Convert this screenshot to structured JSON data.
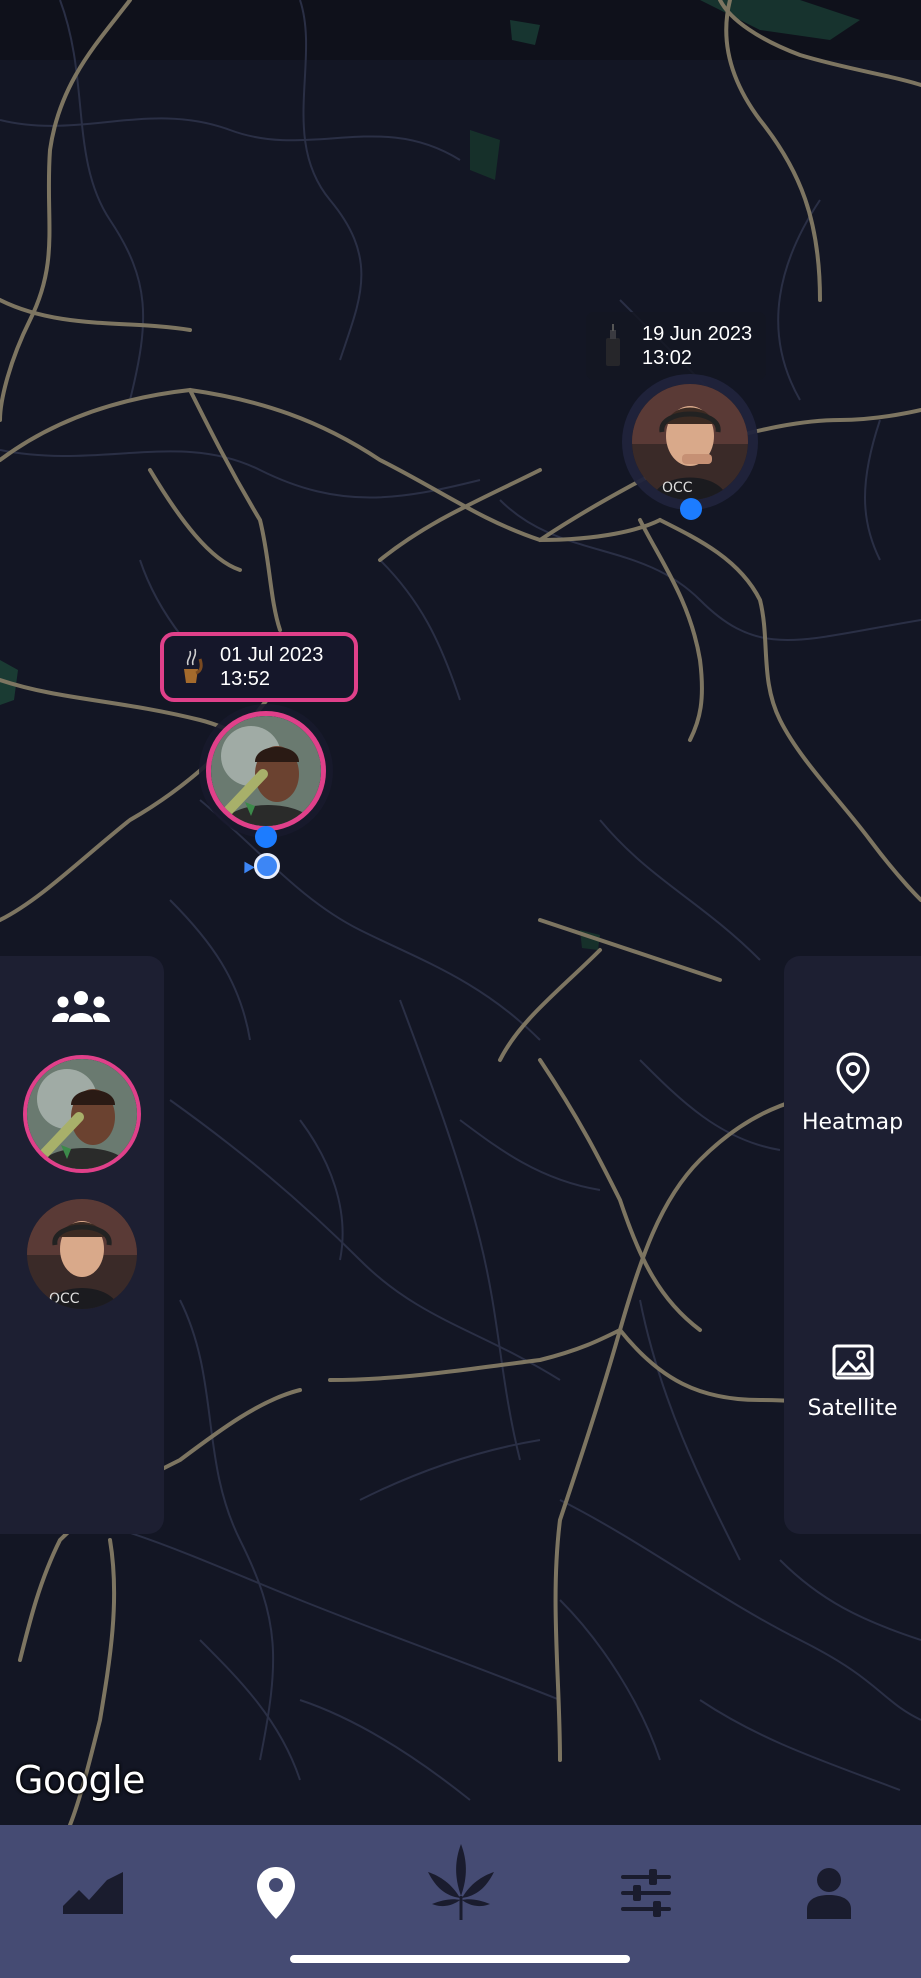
{
  "map": {
    "attribution": "Google",
    "colors": {
      "background": "#131624",
      "major_road": "#8a8068",
      "minor_road": "#2c3146",
      "park": "#1b3a34"
    }
  },
  "markers": [
    {
      "date": "01 Jul 2023",
      "time": "13:52",
      "icon": "pipe-icon",
      "selected": true,
      "ring_color": "#e0408a"
    },
    {
      "date": "19 Jun 2023",
      "time": "13:02",
      "icon": "vape-icon",
      "selected": false
    }
  ],
  "left_panel": {
    "group_icon": "group-icon",
    "friends": [
      {
        "name": "friend-1",
        "active": true
      },
      {
        "name": "friend-2",
        "active": false
      }
    ]
  },
  "right_panel": {
    "heatmap_label": "Heatmap",
    "heatmap_icon": "map-pin-icon",
    "satellite_label": "Satellite",
    "satellite_icon": "image-icon"
  },
  "bottom_nav": {
    "items": [
      {
        "icon": "area-chart-icon",
        "active": false
      },
      {
        "icon": "map-pin-icon",
        "active": true
      },
      {
        "icon": "cannabis-leaf-icon",
        "active": false
      },
      {
        "icon": "sliders-icon",
        "active": false
      },
      {
        "icon": "person-icon",
        "active": false
      }
    ],
    "active_color": "#ffffff",
    "inactive_color": "#1a1c2e"
  }
}
